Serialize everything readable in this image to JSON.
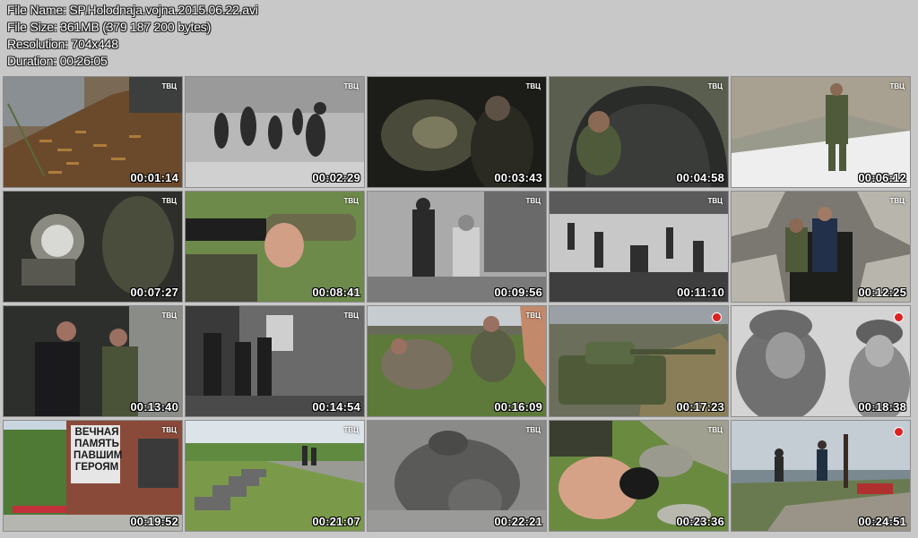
{
  "info": {
    "file_name": "File Name: SP.Holodnaja.vojna.2015.06.22.avi",
    "file_size": "File Size: 361MB (379 187 200 bytes)",
    "resolution": "Resolution: 704x448",
    "duration": "Duration: 00:26:05"
  },
  "thumbnails": [
    {
      "time": "00:01:14",
      "logo": "ТВЦ",
      "scene": "shell-casings-on-ground"
    },
    {
      "time": "00:02:29",
      "logo": "ТВЦ",
      "scene": "archival-people-running"
    },
    {
      "time": "00:03:43",
      "logo": "ТВЦ",
      "scene": "man-in-dark-bunker"
    },
    {
      "time": "00:04:58",
      "logo": "ТВЦ",
      "scene": "man-in-corrugated-tunnel"
    },
    {
      "time": "00:06:12",
      "logo": "ТВЦ",
      "scene": "man-on-snowy-rocks"
    },
    {
      "time": "00:07:27",
      "logo": "ТВЦ",
      "scene": "military-equipment-closeup"
    },
    {
      "time": "00:08:41",
      "logo": "ТВЦ",
      "scene": "hand-holding-grenade-launcher"
    },
    {
      "time": "00:09:56",
      "logo": "ТВЦ",
      "scene": "archival-soldiers-washing"
    },
    {
      "time": "00:11:10",
      "logo": "ТВЦ",
      "scene": "archival-snowy-camp"
    },
    {
      "time": "00:12:25",
      "logo": "ТВЦ",
      "scene": "men-at-rocky-trench"
    },
    {
      "time": "00:13:40",
      "logo": "ТВЦ",
      "scene": "men-in-dark-rocks"
    },
    {
      "time": "00:14:54",
      "logo": "ТВЦ",
      "scene": "archival-soldiers-forest"
    },
    {
      "time": "00:16:09",
      "logo": "ТВЦ",
      "scene": "searchers-digging-tundra"
    },
    {
      "time": "00:17:23",
      "logo": "",
      "scene": "tank-on-field"
    },
    {
      "time": "00:18:38",
      "logo": "",
      "scene": "archival-soldiers-helmets"
    },
    {
      "time": "00:19:52",
      "logo": "ТВЦ",
      "scene": "memorial-wall",
      "memorial_text": [
        "ВЕЧНАЯ",
        "ПАМЯТЬ",
        "ПАВШИМ",
        "ГЕРОЯМ"
      ]
    },
    {
      "time": "00:21:07",
      "logo": "ТВЦ",
      "scene": "memorial-cemetery"
    },
    {
      "time": "00:22:21",
      "logo": "ТВЦ",
      "scene": "archival-soldier-grey"
    },
    {
      "time": "00:23:36",
      "logo": "ТВЦ",
      "scene": "hand-with-helmet-rocks"
    },
    {
      "time": "00:24:51",
      "logo": "",
      "scene": "men-at-hill-monument"
    }
  ]
}
